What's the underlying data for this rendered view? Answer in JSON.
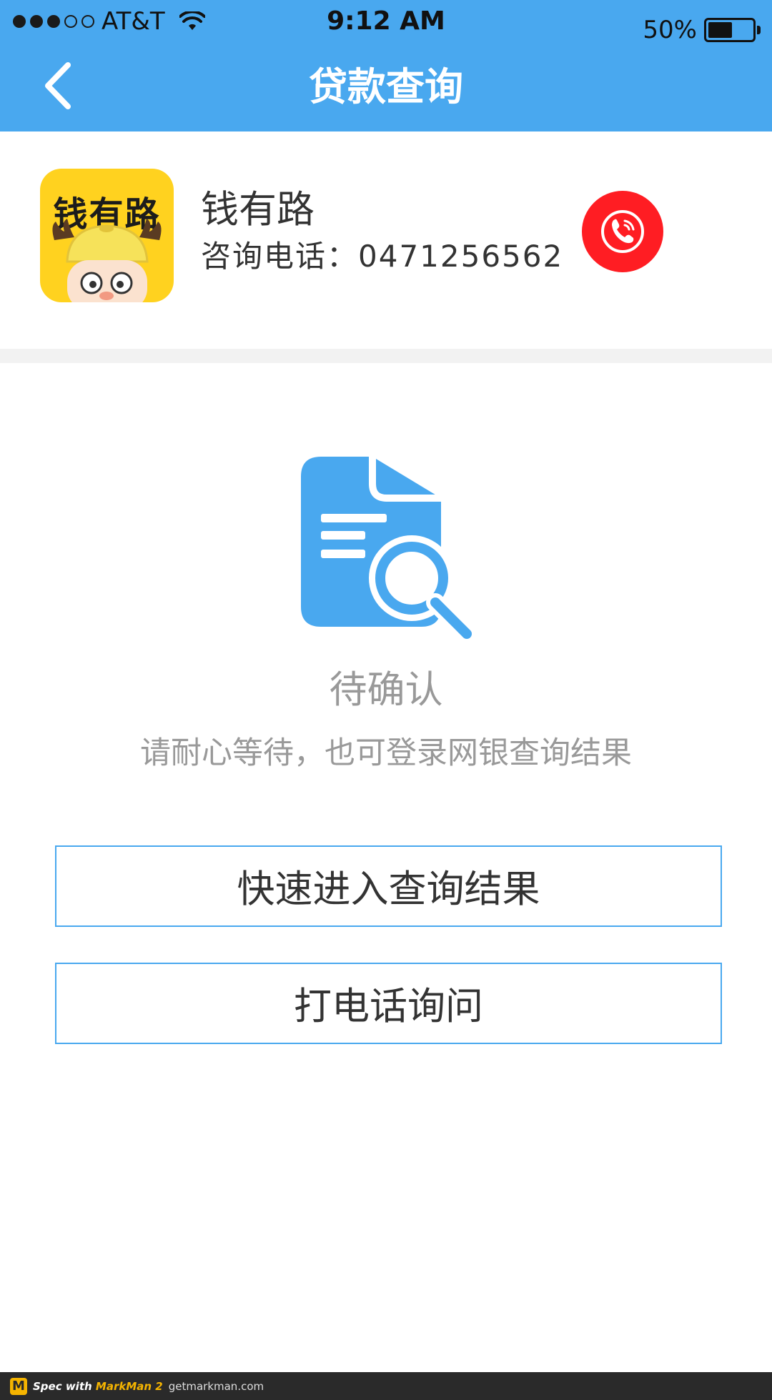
{
  "status_bar": {
    "carrier": "AT&T",
    "time": "9:12 AM",
    "battery_percent": "50%",
    "battery_level": 0.5,
    "signal_bars": 3,
    "signal_total": 5
  },
  "nav": {
    "title": "贷款查询",
    "back_icon": "chevron-left-icon"
  },
  "lender": {
    "logo_text": "钱有路",
    "name": "钱有路",
    "phone_line": "咨询电话：0471256562",
    "call_icon": "phone-icon"
  },
  "result": {
    "icon": "document-search-icon",
    "title": "待确认",
    "hint": "请耐心等待，也可登录网银查询结果"
  },
  "buttons": {
    "query_label": "快速进入查询结果",
    "call_label": "打电话询问"
  },
  "footer": {
    "brand_prefix": "Spec with ",
    "brand_name": "MarkMan 2",
    "site": "getmarkman.com"
  },
  "colors": {
    "primary_blue": "#49a8ef",
    "text_dark": "#333333",
    "text_muted": "#999999",
    "call_red": "#ff1d23",
    "logo_yellow": "#ffd21f"
  }
}
